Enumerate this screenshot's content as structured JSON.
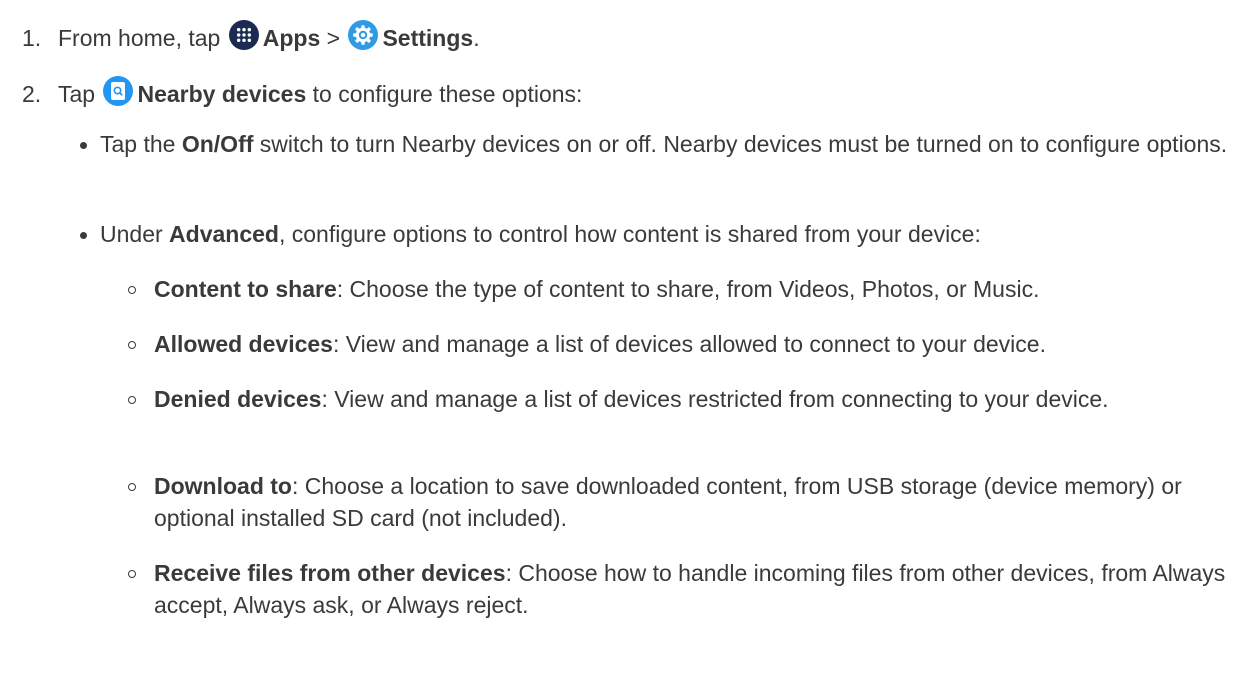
{
  "step1": {
    "number": "1.",
    "prefix": "From home, tap",
    "apps_label": "Apps",
    "separator": ">",
    "settings_label": "Settings",
    "suffix": "."
  },
  "step2": {
    "number": "2.",
    "prefix": "Tap",
    "nearby_label": "Nearby devices",
    "suffix": "to configure these options:"
  },
  "bullets": [
    {
      "pre": "Tap the",
      "bold": "On/Off",
      "text": "switch to turn Nearby devices on or off. Nearby devices must be turned on to configure options."
    },
    {
      "pre": "Under",
      "bold": "Advanced",
      "text": ", configure options to control how content is shared from your device:"
    }
  ],
  "subitems": [
    {
      "bold": "Content to share",
      "text": ": Choose the type of content to share, from Videos, Photos, or Music."
    },
    {
      "bold": "Allowed devices",
      "text": ": View and manage a list of devices allowed to connect to your device."
    },
    {
      "bold": "Denied devices",
      "text": ": View and manage a list of devices restricted from connecting to your device."
    },
    {
      "bold": "Download to",
      "text": ": Choose a location to save downloaded content, from USB storage (device memory) or optional installed SD card (not included)."
    },
    {
      "bold": "Receive files from other devices",
      "text": ": Choose how to handle incoming files from other devices, from Always accept, Always ask, or Always reject."
    }
  ],
  "icons": {
    "apps": "apps-grid-icon",
    "settings": "settings-gear-icon",
    "nearby": "nearby-devices-icon"
  },
  "colors": {
    "text": "#3a3a3a",
    "apps_icon_bg": "#1b2b52",
    "settings_icon_bg": "#2f9be6",
    "nearby_icon_bg": "#2196f3"
  }
}
